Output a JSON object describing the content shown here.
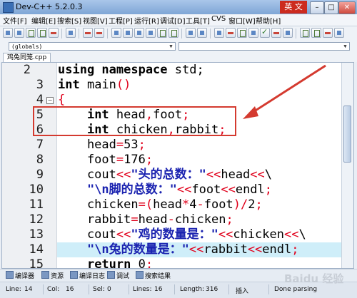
{
  "window": {
    "title": "Dev-C++ 5.2.0.3",
    "ime_label": "英 文",
    "minimize": "–",
    "maximize": "□",
    "close": "✕"
  },
  "menu": [
    "文件[F]",
    "编辑[E]",
    "搜索[S]",
    "视图[V]",
    "工程[P]",
    "运行[R]",
    "调试[D]",
    "工具[T]",
    "CVS",
    "窗口[W]",
    "帮助[H]"
  ],
  "combo": {
    "scope": "(globals)",
    "member": ""
  },
  "file_tab": "鸡兔同笼.cpp",
  "editor": {
    "current_line_highlight_color": "#cfeef9",
    "lines": [
      {
        "n": "2",
        "text": "using namespace std;"
      },
      {
        "n": "3",
        "text": "int main()"
      },
      {
        "n": "4",
        "text": "{"
      },
      {
        "n": "5",
        "text": "    int head,foot;"
      },
      {
        "n": "6",
        "text": "    int chicken,rabbit;"
      },
      {
        "n": "7",
        "text": "    head=53;"
      },
      {
        "n": "8",
        "text": "    foot=176;"
      },
      {
        "n": "9",
        "text": "    cout<<\"头的总数：\"<<head<<\\"
      },
      {
        "n": "10",
        "text": "    \"\\n脚的总数：\"<<foot<<endl;"
      },
      {
        "n": "11",
        "text": "    chicken=(head*4-foot)/2;"
      },
      {
        "n": "12",
        "text": "    rabbit=head-chicken;"
      },
      {
        "n": "13",
        "text": "    cout<<\"鸡的数量是：\"<<chicken<<\\"
      },
      {
        "n": "14",
        "text": "    \"\\n兔的数量是：\"<<rabbit<<endl;"
      },
      {
        "n": "15",
        "text": "    return 0;"
      }
    ]
  },
  "bottom_tabs": [
    "编译器",
    "资源",
    "编译日志",
    "调试",
    "搜索结果"
  ],
  "status": {
    "line_label": "Line:",
    "line": "14",
    "col_label": "Col:",
    "col": "16",
    "sel_label": "Sel:",
    "sel": "0",
    "lines_label": "Lines:",
    "lines": "16",
    "length_label": "Length:",
    "length": "316",
    "mode": "插入",
    "state": "Done parsing"
  },
  "annotation_color": "#d43a2f",
  "watermark": "Baidu 经验"
}
